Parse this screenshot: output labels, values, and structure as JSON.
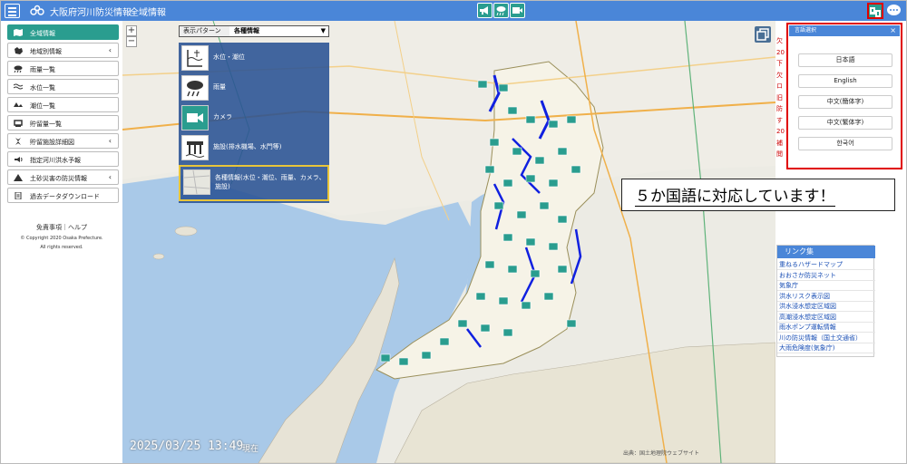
{
  "header": {
    "app_title": "大阪府河川防災情報",
    "page_title": "全域情報",
    "buttons": [
      "megaphone-icon",
      "rain-camera-icon",
      "video-camera-icon"
    ],
    "colors": {
      "bar": "#4a86d8",
      "button": "#2a9d8f",
      "highlight": "#e00000"
    }
  },
  "sidebar": {
    "items": [
      {
        "label": "全域情報",
        "icon": "map-icon",
        "active": true,
        "expandable": false
      },
      {
        "label": "地域別情報",
        "icon": "regions-icon",
        "active": false,
        "expandable": true
      },
      {
        "label": "雨量一覧",
        "icon": "rain-cloud-icon",
        "active": false,
        "expandable": false
      },
      {
        "label": "水位一覧",
        "icon": "water-level-icon",
        "active": false,
        "expandable": false
      },
      {
        "label": "潮位一覧",
        "icon": "tide-icon",
        "active": false,
        "expandable": false
      },
      {
        "label": "貯留量一覧",
        "icon": "storage-icon",
        "active": false,
        "expandable": false
      },
      {
        "label": "貯留施設詳細図",
        "icon": "facility-icon",
        "active": false,
        "expandable": true
      },
      {
        "label": "指定河川洪水予報",
        "icon": "flood-forecast-icon",
        "active": false,
        "expandable": false
      },
      {
        "label": "土砂災害の防災情報",
        "icon": "warning-icon",
        "active": false,
        "expandable": true
      },
      {
        "label": "過去データダウンロード",
        "icon": "download-icon",
        "active": false,
        "expandable": false
      }
    ],
    "disclaimer": "免責事項｜ヘルプ",
    "copyright": "© Copyright 2020 Osaka Prefecture.",
    "rights": "All rights reserved."
  },
  "map": {
    "zoom_in": "+",
    "zoom_out": "−",
    "pattern_label": "表示パターン",
    "pattern_value": "各種情報",
    "pattern_arrow": "▼",
    "layers": [
      {
        "label": "水位・潮位",
        "icon": "water-gauge-icon"
      },
      {
        "label": "雨量",
        "icon": "rain-cloud-icon"
      },
      {
        "label": "カメラ",
        "icon": "video-camera-icon"
      },
      {
        "label": "施設(排水機場、水門等)",
        "icon": "floodgate-icon"
      }
    ],
    "layer_all": "各種情報(水位・潮位、雨量、カメラ、施設)",
    "place_labels": [
      "家島諸島",
      "明石海峡大橋",
      "大",
      "阪",
      "播",
      "磨",
      "灘",
      "友ヶ島水道",
      "紀",
      "鳴"
    ],
    "timestamp": "2025/03/25 13:49",
    "timestamp_suffix": "現在",
    "attribution": "出典：国土地理院ウェブサイト"
  },
  "callout": "５か国語に対応しています！",
  "info_strip": [
    "欠",
    "20",
    "下",
    "欠",
    "ロ",
    "旧",
    "防",
    "す",
    "20",
    "補",
    "閲",
    "無",
    "円"
  ],
  "language_panel": {
    "title": "言語選択",
    "close": "×",
    "options": [
      "日本語",
      "English",
      "中文(簡体字)",
      "中文(繁体字)",
      "한국어"
    ]
  },
  "links": {
    "title": "リンク集",
    "items": [
      "重ねるハザードマップ",
      "おおさか防災ネット",
      "気象庁",
      "洪水リスク表示図",
      "洪水浸水想定区域図",
      "高潮浸水想定区域図",
      "雨水ポンプ運転情報",
      "川の防災情報（国土交通省）",
      "大雨危険度(気象庁)"
    ]
  }
}
